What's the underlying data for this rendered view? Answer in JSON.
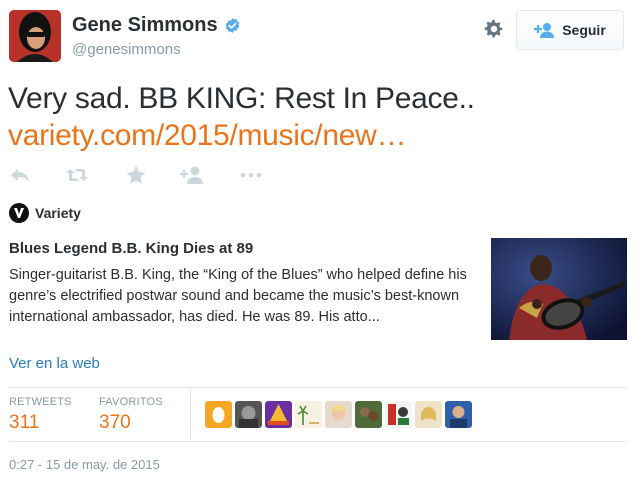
{
  "header": {
    "name": "Gene Simmons",
    "handle": "@genesimmons",
    "follow_label": "Seguir"
  },
  "tweet": {
    "text": "Very sad. BB KING: Rest In Peace..",
    "link": "variety.com/2015/music/new…"
  },
  "actions": {
    "icons": [
      "reply-icon",
      "retweet-icon",
      "favorite-icon",
      "follow-user-icon",
      "more-icon"
    ]
  },
  "card": {
    "source": "Variety",
    "title": "Blues Legend B.B. King Dies at 89",
    "description": "Singer-guitarist B.B. King, the “King of the Blues” who helped define his genre’s electrified postwar sound and became the music’s best-known international ambassador, has died. He was 89. His atto...",
    "view_link": "Ver en la web"
  },
  "stats": {
    "retweets_label": "RETWEETS",
    "retweets_value": "311",
    "favorites_label": "FAVORITOS",
    "favorites_value": "370"
  },
  "timestamp": "0:27 - 15 de may. de 2015",
  "colors": {
    "accent": "#e8751a",
    "link": "#2b7bb9",
    "muted": "#8899a6",
    "verified": "#55acee"
  }
}
